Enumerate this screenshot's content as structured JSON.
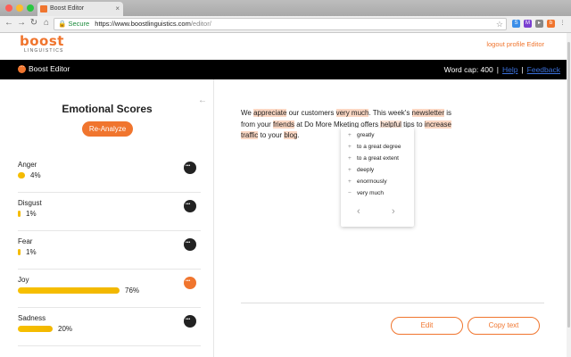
{
  "browser": {
    "tab_title": "Boost Editor",
    "secure_label": "Secure",
    "url_domain": "https://www.boostlinguistics.com",
    "url_path": "/editor/"
  },
  "header": {
    "logo_word": "boost",
    "logo_sub": "LINGUISTICS",
    "links": [
      "logout",
      "profile",
      "Editor"
    ]
  },
  "darkbar": {
    "app_name": "Boost Editor",
    "word_cap": "Word cap: 400",
    "help": "Help",
    "feedback": "Feedback"
  },
  "left": {
    "title": "Emotional Scores",
    "reanalyze": "Re-Analyze",
    "emotions": [
      {
        "name": "Anger",
        "pct_label": "4%",
        "value": 4
      },
      {
        "name": "Disgust",
        "pct_label": "1%",
        "value": 1
      },
      {
        "name": "Fear",
        "pct_label": "1%",
        "value": 1
      },
      {
        "name": "Joy",
        "pct_label": "76%",
        "value": 76
      },
      {
        "name": "Sadness",
        "pct_label": "20%",
        "value": 20
      }
    ]
  },
  "editor": {
    "t1": "We ",
    "w_appreciate": "appreciate",
    "t2": " our customers ",
    "w_verymuch": "very much",
    "t3": ". This week's ",
    "w_newsletter": "newsletter",
    "t4": " is from your ",
    "w_friends": "friends",
    "t5": " at Do More M",
    "t6": "keting offers ",
    "w_helpful": "helpful",
    "t7": " tips to ",
    "w_increase": "increase",
    "t8": " ",
    "w_traffic": "traffic",
    "t9": " to your ",
    "w_blog": "blog",
    "t10": "."
  },
  "suggestions": {
    "items": [
      {
        "sign": "+",
        "text": "greatly"
      },
      {
        "sign": "+",
        "text": "to a great degree"
      },
      {
        "sign": "+",
        "text": "to a great extent"
      },
      {
        "sign": "+",
        "text": "deeply"
      },
      {
        "sign": "+",
        "text": "enormously"
      },
      {
        "sign": "−",
        "text": "very much"
      }
    ]
  },
  "actions": {
    "edit": "Edit",
    "copy": "Copy text"
  },
  "colors": {
    "accent": "#f0752e",
    "bar": "#f7c000",
    "highlight": "#fbd7c3"
  }
}
